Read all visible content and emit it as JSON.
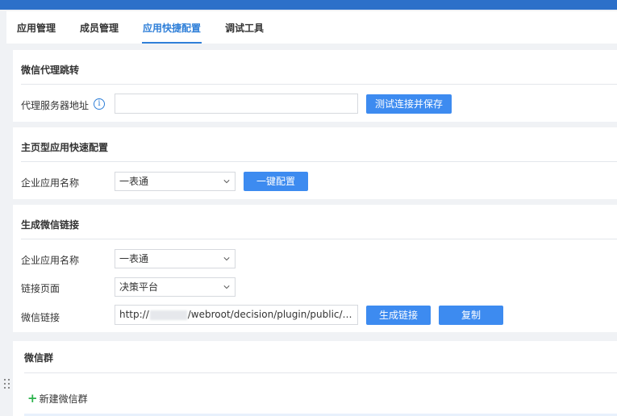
{
  "tabs": [
    {
      "label": "应用管理",
      "active": false
    },
    {
      "label": "成员管理",
      "active": false
    },
    {
      "label": "应用快捷配置",
      "active": true
    },
    {
      "label": "调试工具",
      "active": false
    }
  ],
  "colors": {
    "accent": "#2f7fd8",
    "button": "#3d8bf0",
    "topbar": "#2c70c9",
    "add_icon": "#2bb24c"
  },
  "proxy": {
    "title": "微信代理跳转",
    "server_label": "代理服务器地址",
    "server_value": "",
    "test_save_button": "测试连接并保存"
  },
  "homepage": {
    "title": "主页型应用快速配置",
    "app_name_label": "企业应用名称",
    "app_name_value": "一表通",
    "one_click_button": "一键配置"
  },
  "link": {
    "title": "生成微信链接",
    "app_name_label": "企业应用名称",
    "app_name_value": "一表通",
    "page_label": "链接页面",
    "page_value": "决策平台",
    "wechat_link_label": "微信链接",
    "link_prefix": "http://",
    "link_suffix": "/webroot/decision/plugin/public/c...",
    "generate_button": "生成链接",
    "copy_button": "复制"
  },
  "group": {
    "title": "微信群",
    "new_group_label": "新建微信群"
  }
}
